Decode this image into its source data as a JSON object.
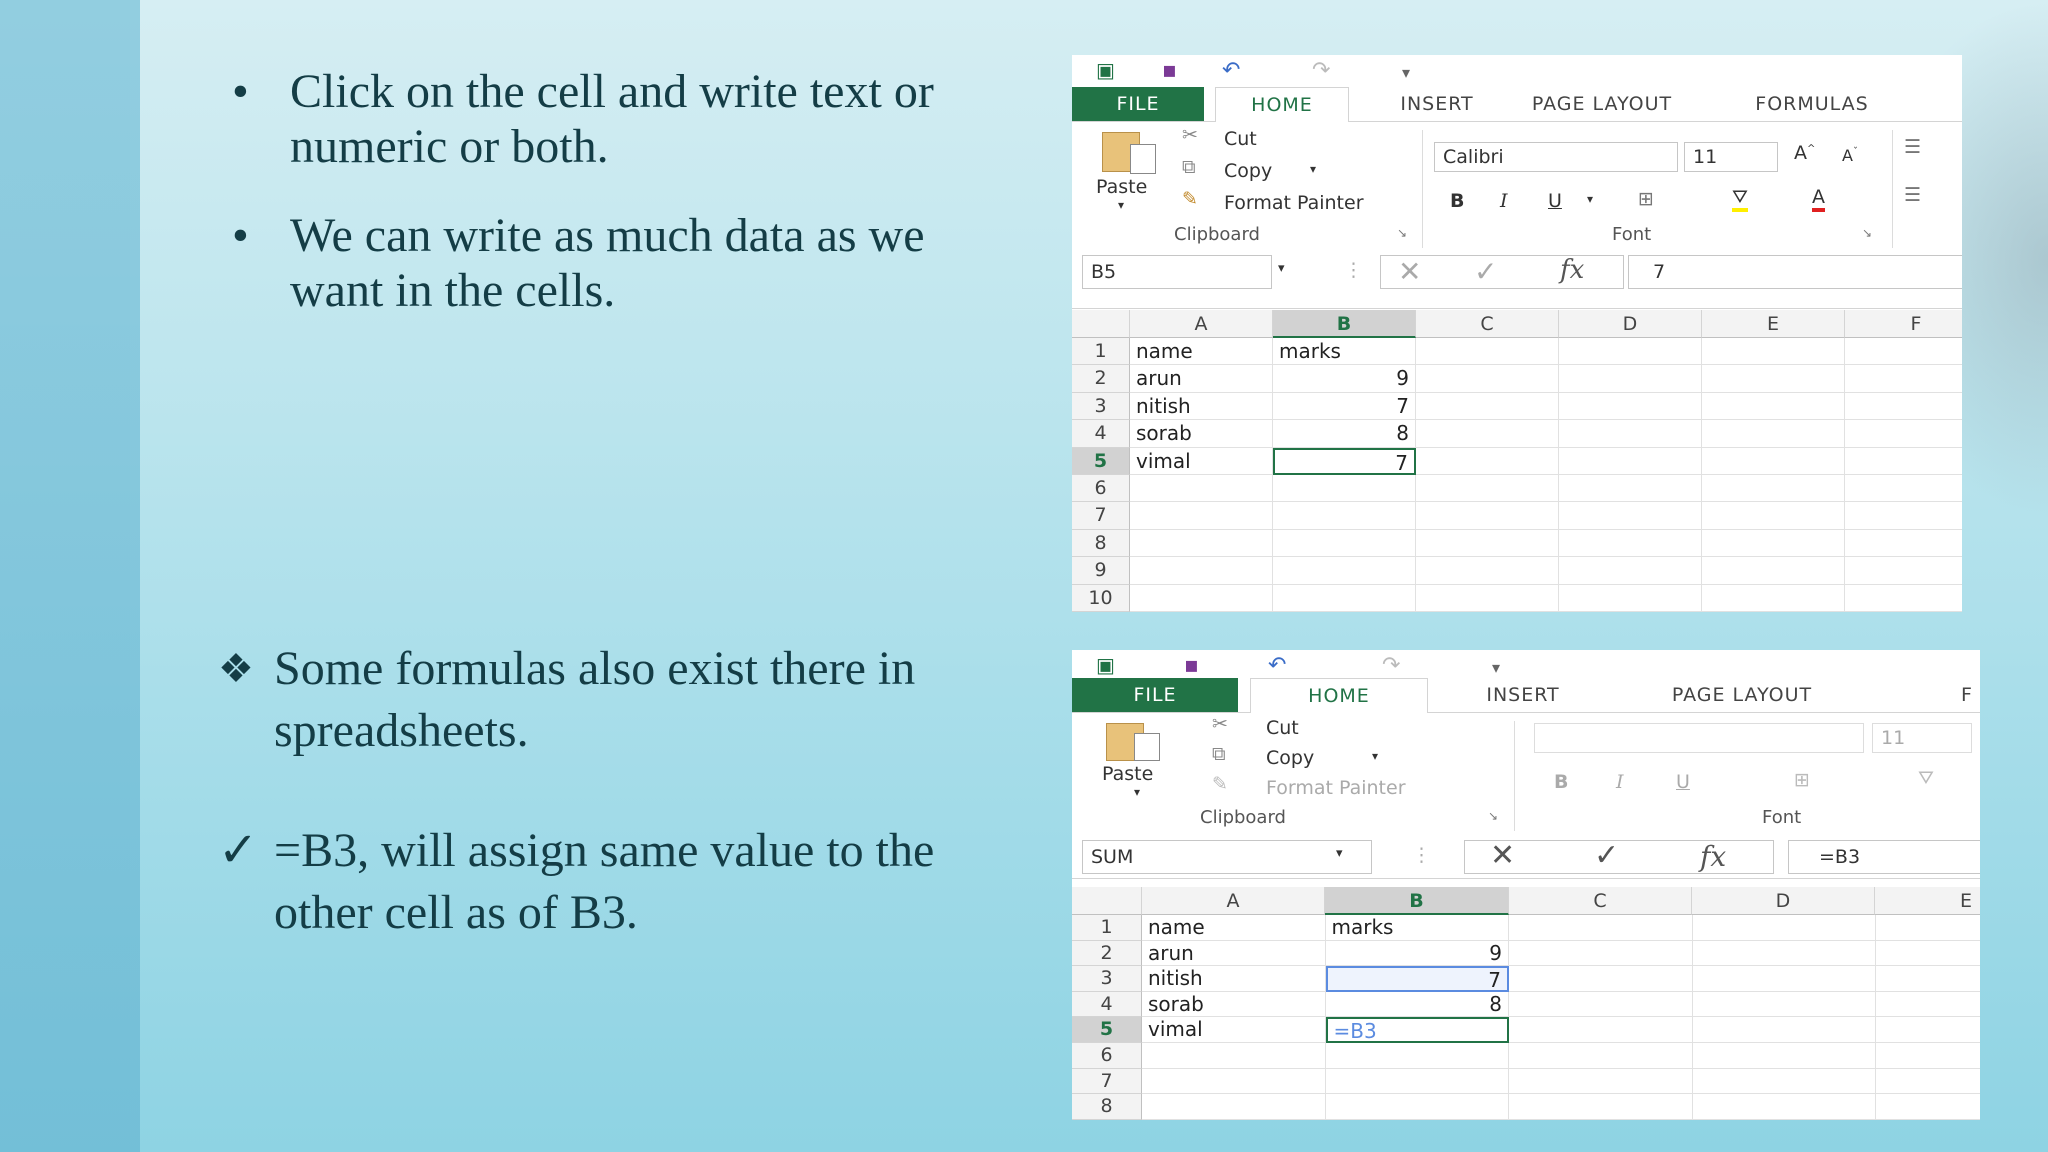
{
  "slide": {
    "bullets_top": [
      {
        "marker": "•",
        "text": "Click on the cell and write text or numeric or both."
      },
      {
        "marker": "•",
        "text": "We can write as much data as we want in the cells."
      }
    ],
    "bullet_formula": {
      "marker": "❖",
      "text": "Some formulas also exist there in spreadsheets."
    },
    "bullet_check": {
      "marker": "✓",
      "text": " =B3, will assign same value to the other cell as of B3."
    }
  },
  "excel1": {
    "tabs": [
      "FILE",
      "HOME",
      "INSERT",
      "PAGE LAYOUT",
      "FORMULAS"
    ],
    "clipboard": {
      "paste": "Paste",
      "cut": "Cut",
      "copy": "Copy",
      "format_painter": "Format Painter",
      "group": "Clipboard"
    },
    "font": {
      "name": "Calibri",
      "size": "11",
      "group": "Font",
      "bold": "B",
      "italic": "I",
      "underline": "U"
    },
    "name_box": "B5",
    "formula": "7",
    "columns": [
      "A",
      "B",
      "C",
      "D",
      "E",
      "F"
    ],
    "rows": [
      "1",
      "2",
      "3",
      "4",
      "5",
      "6",
      "7",
      "8",
      "9",
      "10"
    ],
    "data": [
      [
        "name",
        "marks"
      ],
      [
        "arun",
        "9"
      ],
      [
        "nitish",
        "7"
      ],
      [
        "sorab",
        "8"
      ],
      [
        "vimal",
        "7"
      ]
    ]
  },
  "excel2": {
    "tabs": [
      "FILE",
      "HOME",
      "INSERT",
      "PAGE LAYOUT",
      "F"
    ],
    "clipboard": {
      "paste": "Paste",
      "cut": "Cut",
      "copy": "Copy",
      "format_painter": "Format Painter",
      "group": "Clipboard"
    },
    "font": {
      "size": "11",
      "group": "Font",
      "bold": "B",
      "italic": "I",
      "underline": "U"
    },
    "name_box": "SUM",
    "formula": "=B3",
    "columns": [
      "A",
      "B",
      "C",
      "D",
      "E"
    ],
    "rows": [
      "1",
      "2",
      "3",
      "4",
      "5",
      "6",
      "7",
      "8"
    ],
    "data": [
      [
        "name",
        "marks"
      ],
      [
        "arun",
        "9"
      ],
      [
        "nitish",
        "7"
      ],
      [
        "sorab",
        "8"
      ],
      [
        "vimal",
        "=B3"
      ]
    ]
  },
  "colors": {
    "excel_green": "#217346",
    "text": "#143d46",
    "ref_blue": "#5b8be0"
  }
}
